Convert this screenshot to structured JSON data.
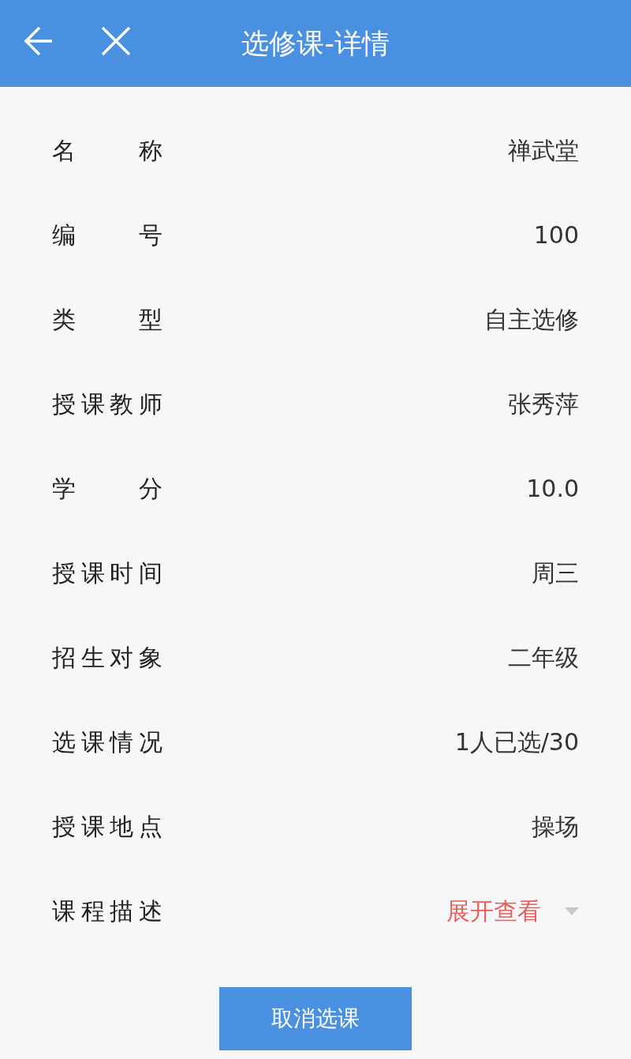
{
  "header": {
    "title": "选修课-详情"
  },
  "fields": [
    {
      "label": "名称",
      "value": "禅武堂",
      "kind": "text"
    },
    {
      "label": "编号",
      "value": "100",
      "kind": "text"
    },
    {
      "label": "类型",
      "value": "自主选修",
      "kind": "text"
    },
    {
      "label": "授课教师",
      "value": "张秀萍",
      "kind": "text"
    },
    {
      "label": "学分",
      "value": "10.0",
      "kind": "text"
    },
    {
      "label": "授课时间",
      "value": "周三",
      "kind": "text"
    },
    {
      "label": "招生对象",
      "value": "二年级",
      "kind": "text"
    },
    {
      "label": "选课情况",
      "value": "1人已选/30",
      "kind": "text"
    },
    {
      "label": "授课地点",
      "value": "操场",
      "kind": "text"
    },
    {
      "label": "课程描述",
      "value": "展开查看",
      "kind": "expander",
      "expanded": false
    }
  ],
  "action_button": "取消选课"
}
